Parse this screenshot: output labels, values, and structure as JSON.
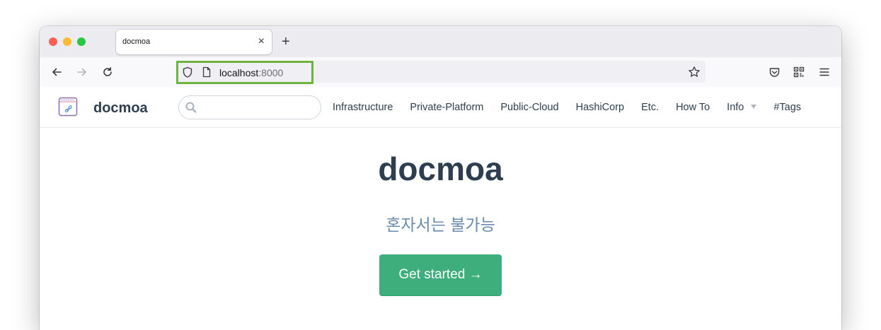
{
  "browser": {
    "tab_title": "docmoa",
    "url_host": "localhost",
    "url_port": ":8000",
    "highlight_color": "#6db33f"
  },
  "site": {
    "brand": "docmoa",
    "search_placeholder": "",
    "nav": [
      "Infrastructure",
      "Private-Platform",
      "Public-Cloud",
      "HashiCorp",
      "Etc.",
      "How To",
      "Info",
      "#Tags"
    ]
  },
  "hero": {
    "title": "docmoa",
    "description": "혼자서는 불가능",
    "cta_label": "Get started →",
    "cta_color": "#3eaf7c"
  },
  "icons": [
    "back-icon",
    "forward-icon",
    "reload-icon",
    "shield-icon",
    "page-icon",
    "bookmark-star-icon",
    "pocket-icon",
    "qr-code-icon",
    "menu-icon",
    "search-icon",
    "logo-icon"
  ]
}
